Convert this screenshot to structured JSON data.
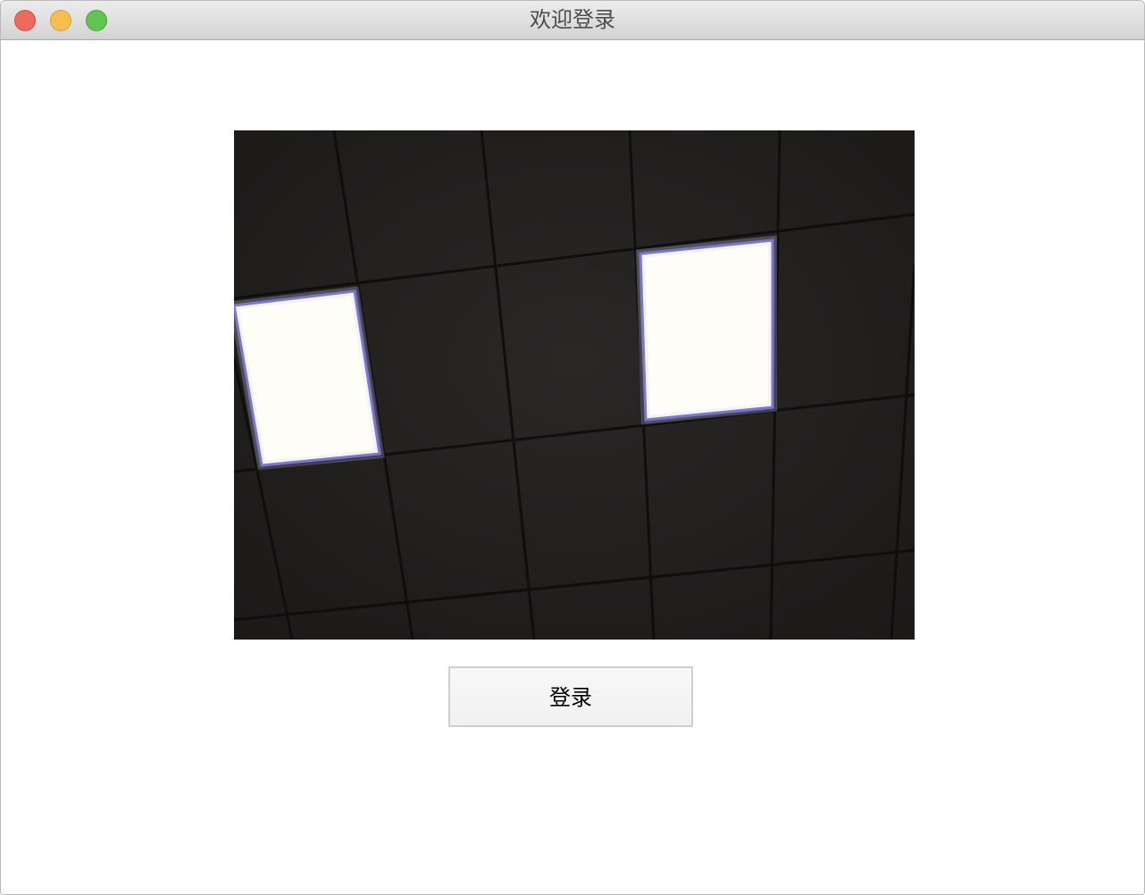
{
  "window": {
    "title": "欢迎登录"
  },
  "camera": {
    "icon": "camera-feed-image"
  },
  "actions": {
    "login_label": "登录"
  },
  "colors": {
    "close": "#ee6a5f",
    "minimize": "#f5bf4f",
    "maximize": "#61c554",
    "panel": "#211f1f",
    "light": "#fffdf8"
  }
}
